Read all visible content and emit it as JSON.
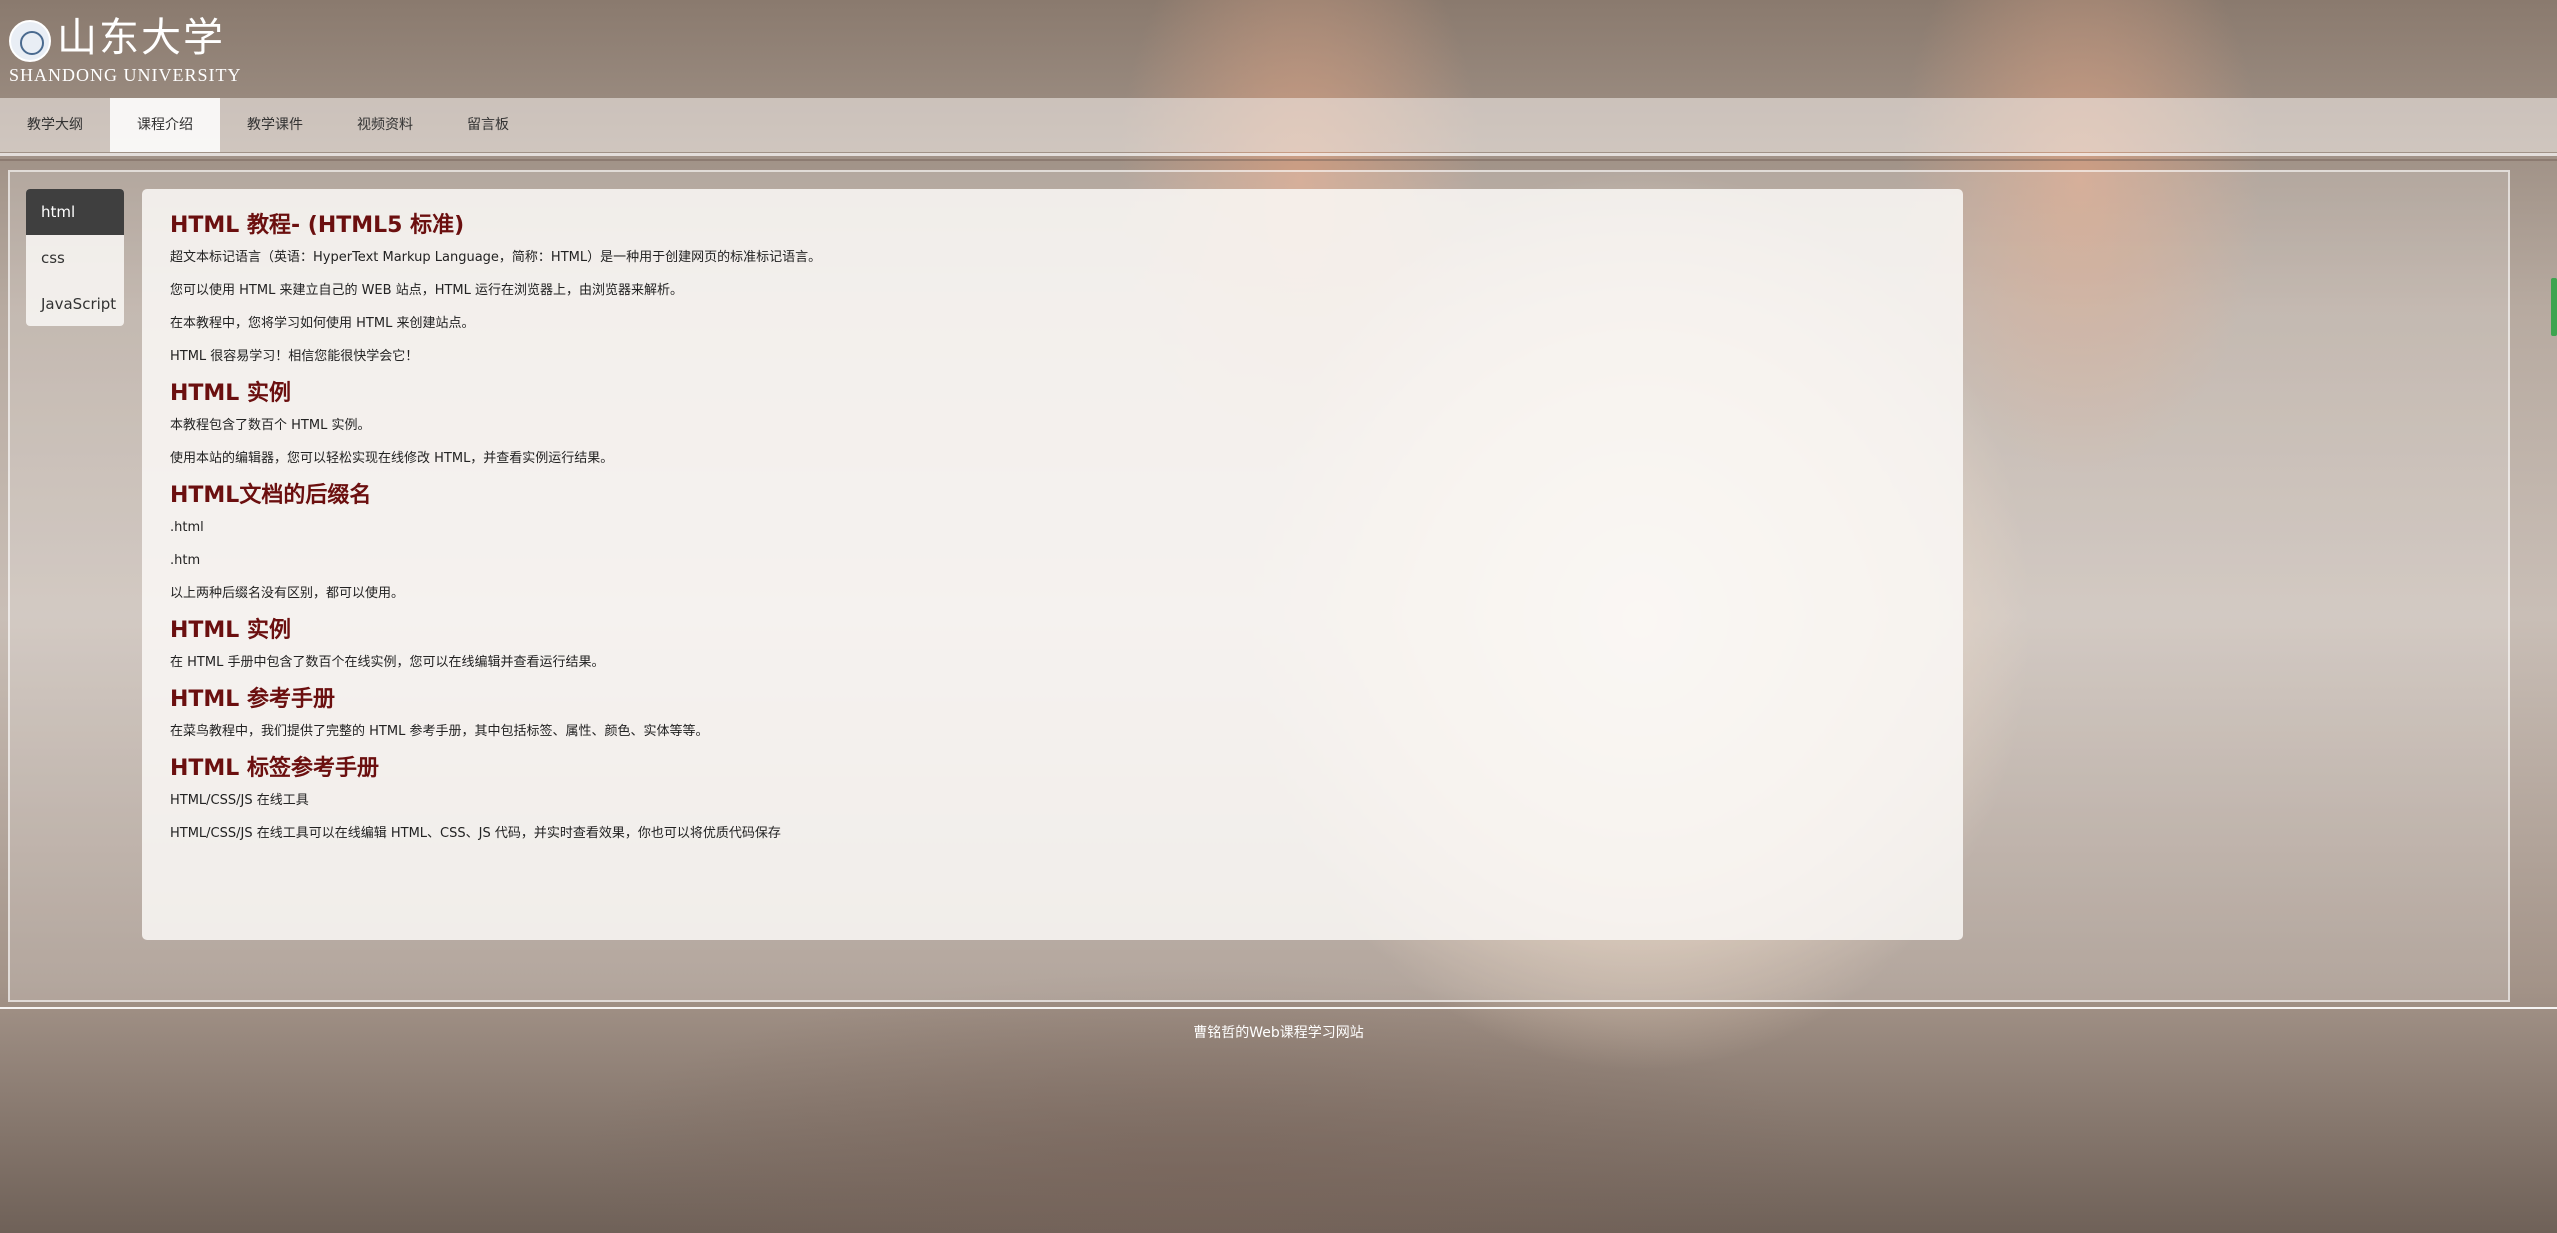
{
  "header": {
    "logo_cn": "山东大学",
    "logo_en": "SHANDONG UNIVERSITY"
  },
  "nav": {
    "items": [
      "教学大纲",
      "课程介绍",
      "教学课件",
      "视频资料",
      "留言板"
    ],
    "active": "课程介绍"
  },
  "sidebar": {
    "items": [
      "html",
      "css",
      "JavaScript"
    ],
    "active": "html"
  },
  "content": {
    "sections": [
      {
        "heading": "HTML 教程- (HTML5 标准)",
        "paragraphs": [
          "超文本标记语言（英语：HyperText Markup Language，简称：HTML）是一种用于创建网页的标准标记语言。",
          "您可以使用 HTML 来建立自己的 WEB 站点，HTML 运行在浏览器上，由浏览器来解析。",
          "在本教程中，您将学习如何使用 HTML 来创建站点。",
          "HTML 很容易学习！相信您能很快学会它！"
        ]
      },
      {
        "heading": "HTML 实例",
        "paragraphs": [
          "本教程包含了数百个 HTML 实例。",
          "使用本站的编辑器，您可以轻松实现在线修改 HTML，并查看实例运行结果。"
        ]
      },
      {
        "heading": "HTML文档的后缀名",
        "paragraphs": [
          ".html",
          ".htm",
          "以上两种后缀名没有区别，都可以使用。"
        ]
      },
      {
        "heading": "HTML 实例",
        "paragraphs": [
          "在 HTML 手册中包含了数百个在线实例，您可以在线编辑并查看运行结果。"
        ]
      },
      {
        "heading": "HTML 参考手册",
        "paragraphs": [
          "在菜鸟教程中，我们提供了完整的 HTML 参考手册，其中包括标签、属性、颜色、实体等等。"
        ]
      },
      {
        "heading": "HTML 标签参考手册",
        "paragraphs": [
          "HTML/CSS/JS 在线工具",
          "HTML/CSS/JS 在线工具可以在线编辑 HTML、CSS、JS 代码，并实时查看效果，你也可以将优质代码保存"
        ]
      }
    ]
  },
  "footer": {
    "text": "曹铭哲的Web课程学习网站"
  },
  "colors": {
    "heading": "#6b0f0f",
    "active_side": "#3f3f3f",
    "scroll_mark": "#3da44f"
  }
}
